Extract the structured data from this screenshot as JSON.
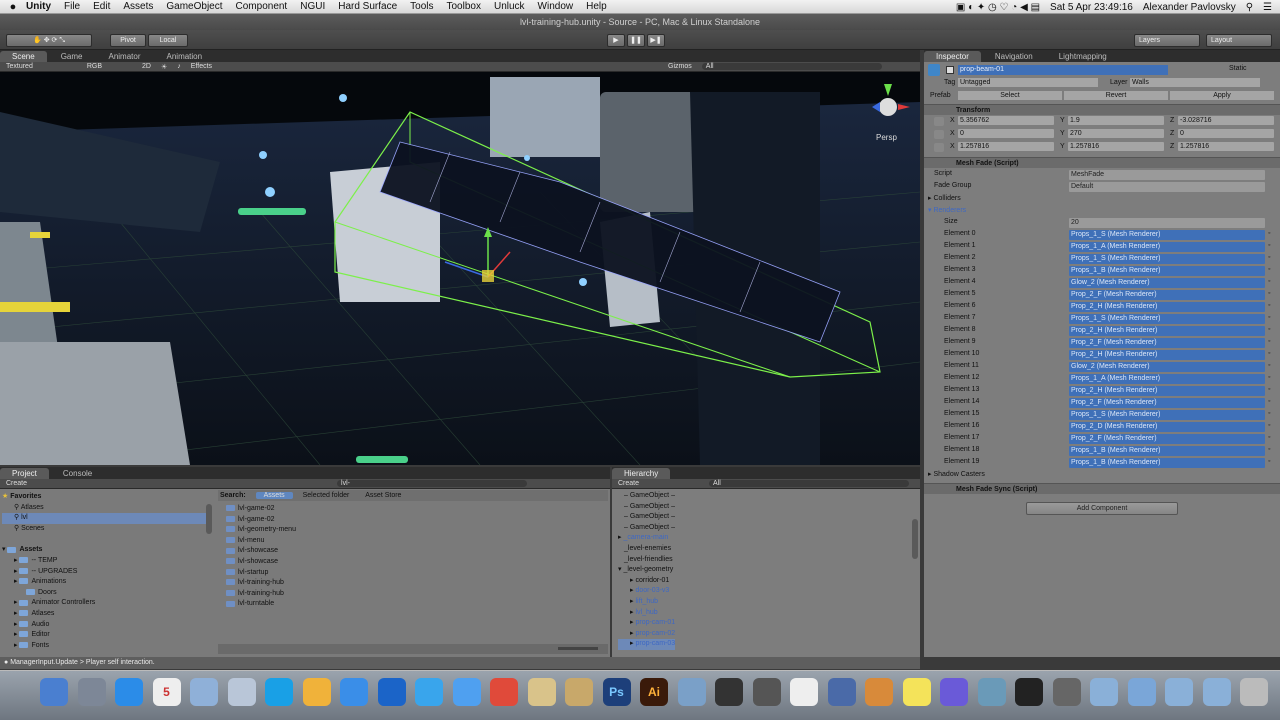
{
  "menubar": {
    "apple": "",
    "items": [
      "Unity",
      "File",
      "Edit",
      "Assets",
      "GameObject",
      "Component",
      "NGUI",
      "Hard Surface",
      "Tools",
      "Toolbox",
      "Unluck",
      "Window",
      "Help"
    ],
    "clock": "Sat 5 Apr  23:49:16",
    "user": "Alexander Pavlovsky"
  },
  "window_title": "lvl-training-hub.unity - Source - PC, Mac & Linux Standalone",
  "toolbar": {
    "pivot": "Pivot",
    "local": "Local",
    "layers": "Layers",
    "layout": "Layout"
  },
  "scene_tabs": [
    "Scene",
    "Game",
    "Animator",
    "Animation"
  ],
  "scene_bar": {
    "mode": "Textured",
    "color": "RGB",
    "dim": "2D",
    "effects": "Effects",
    "gizmos": "Gizmos",
    "search": "All"
  },
  "persp_label": "Persp",
  "inspector": {
    "tabs": [
      "Inspector",
      "Navigation",
      "Lightmapping"
    ],
    "object_name": "prop-beam-01",
    "static": "Static",
    "tag_label": "Tag",
    "tag_value": "Untagged",
    "layer_label": "Layer",
    "layer_value": "Walls",
    "prefab_label": "Prefab",
    "prefab_buttons": [
      "Select",
      "Revert",
      "Apply"
    ],
    "transform": "Transform",
    "position": {
      "x": "5.356762",
      "y": "1.9",
      "z": "-3.028716"
    },
    "rotation": {
      "x": "0",
      "y": "270",
      "z": "0"
    },
    "scale": {
      "x": "1.257816",
      "y": "1.257816",
      "z": "1.257816"
    },
    "meshfade": "Mesh Fade (Script)",
    "script_label": "Script",
    "script_value": "MeshFade",
    "fadegroup_label": "Fade Group",
    "fadegroup_value": "Default",
    "colliders": "Colliders",
    "renderers": "Renderers",
    "size_label": "Size",
    "size_value": "20",
    "elements": [
      {
        "l": "Element 0",
        "v": "Props_1_S (Mesh Renderer)"
      },
      {
        "l": "Element 1",
        "v": "Props_1_A (Mesh Renderer)"
      },
      {
        "l": "Element 2",
        "v": "Props_1_S (Mesh Renderer)"
      },
      {
        "l": "Element 3",
        "v": "Props_1_B (Mesh Renderer)"
      },
      {
        "l": "Element 4",
        "v": "Glow_2 (Mesh Renderer)"
      },
      {
        "l": "Element 5",
        "v": "Prop_2_F (Mesh Renderer)"
      },
      {
        "l": "Element 6",
        "v": "Prop_2_H (Mesh Renderer)"
      },
      {
        "l": "Element 7",
        "v": "Props_1_S (Mesh Renderer)"
      },
      {
        "l": "Element 8",
        "v": "Prop_2_H (Mesh Renderer)"
      },
      {
        "l": "Element 9",
        "v": "Prop_2_F (Mesh Renderer)"
      },
      {
        "l": "Element 10",
        "v": "Prop_2_H (Mesh Renderer)"
      },
      {
        "l": "Element 11",
        "v": "Glow_2 (Mesh Renderer)"
      },
      {
        "l": "Element 12",
        "v": "Props_1_A (Mesh Renderer)"
      },
      {
        "l": "Element 13",
        "v": "Prop_2_H (Mesh Renderer)"
      },
      {
        "l": "Element 14",
        "v": "Prop_2_F (Mesh Renderer)"
      },
      {
        "l": "Element 15",
        "v": "Props_1_S (Mesh Renderer)"
      },
      {
        "l": "Element 16",
        "v": "Prop_2_D (Mesh Renderer)"
      },
      {
        "l": "Element 17",
        "v": "Prop_2_F (Mesh Renderer)"
      },
      {
        "l": "Element 18",
        "v": "Props_1_B (Mesh Renderer)"
      },
      {
        "l": "Element 19",
        "v": "Props_1_B (Mesh Renderer)"
      }
    ],
    "shadow_casters": "Shadow Casters",
    "meshfadesync": "Mesh Fade Sync (Script)",
    "add_component": "Add Component"
  },
  "project": {
    "tabs": [
      "Project",
      "Console"
    ],
    "create": "Create",
    "favorites": "Favorites",
    "fav_items": [
      "Atlases",
      "lvl",
      "Scenes"
    ],
    "assets": "Assets",
    "asset_items": [
      "-- TEMP",
      "-- UPGRADES",
      "Animations",
      "Doors",
      "Animator Controllers",
      "Atlases",
      "Audio",
      "Editor",
      "Fonts"
    ],
    "search_label": "Search:",
    "search_scopes": [
      "Assets",
      "Selected folder",
      "Asset Store"
    ],
    "search_value": "lvl-",
    "results": [
      "lvl-game-02",
      "lvl-game-02",
      "lvl-geometry-menu",
      "lvl-menu",
      "lvl-showcase",
      "lvl-showcase",
      "lvl-startup",
      "lvl-training-hub",
      "lvl-training-hub",
      "lvl-turntable"
    ]
  },
  "hierarchy": {
    "tab": "Hierarchy",
    "create": "Create",
    "search": "All",
    "items": [
      {
        "t": "– GameObject –",
        "cls": ""
      },
      {
        "t": "– GameObject –",
        "cls": ""
      },
      {
        "t": "– GameObject –",
        "cls": ""
      },
      {
        "t": "– GameObject –",
        "cls": ""
      },
      {
        "t": "_camera-main",
        "cls": "blue"
      },
      {
        "t": "_level-enemies",
        "cls": ""
      },
      {
        "t": "_level-friendlies",
        "cls": ""
      },
      {
        "t": "_level-geometry",
        "cls": ""
      },
      {
        "t": "corridor-01",
        "cls": ""
      },
      {
        "t": "door-03-v3",
        "cls": "blue"
      },
      {
        "t": "lift_hub",
        "cls": "blue"
      },
      {
        "t": "lvl_hub",
        "cls": "blue"
      },
      {
        "t": "prop-cam-01",
        "cls": "blue"
      },
      {
        "t": "prop-cam-02",
        "cls": "blue"
      },
      {
        "t": "prop-cam-03",
        "cls": "blue"
      }
    ]
  },
  "status": "ManagerInput.Update > Player self interaction.",
  "dock_icons": [
    "finder-icon",
    "launchpad-icon",
    "appstore-icon",
    "calendar-icon",
    "mail-icon",
    "preview-icon",
    "skype-icon",
    "photos-icon",
    "safari-icon",
    "teamviewer-icon",
    "twitter-icon",
    "messages-icon",
    "chrome-icon",
    "folder-icon",
    "cocoa-icon",
    "photoshop-icon",
    "illustrator-icon",
    "safari2-icon",
    "unity-icon",
    "unity2-icon",
    "notes-icon",
    "xcode-icon",
    "tool-icon",
    "sticky-icon",
    "itunes-icon",
    "photo-icon",
    "terminal-icon",
    "activity-icon",
    "documents-icon",
    "downloads-icon",
    "applications-icon",
    "folder2-icon",
    "trash-icon"
  ],
  "dock_labels": {
    "calendar": "5",
    "photoshop": "Ps",
    "illustrator": "Ai"
  }
}
